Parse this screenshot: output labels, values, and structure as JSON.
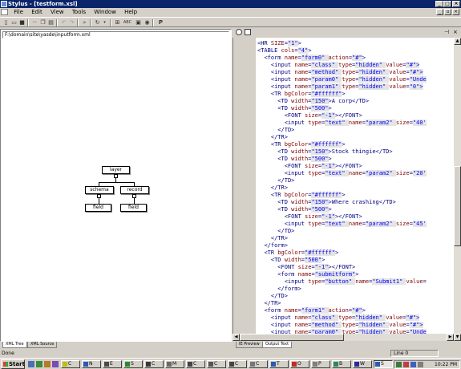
{
  "window": {
    "title": "Stylus - [testform.xsl]"
  },
  "menu": {
    "items": [
      "File",
      "Edit",
      "View",
      "Tools",
      "Window",
      "Help"
    ]
  },
  "toolbar": {
    "abc_label": "ABC",
    "p_label": "P"
  },
  "left_pane": {
    "path": "F:\\domain\\site\\yasde\\inputform.xml",
    "tree": {
      "root": "layer",
      "child1": "schema",
      "child2": "record",
      "leaf1": "field",
      "leaf2": "field"
    },
    "tabs": [
      "XML Tree",
      "XML Source"
    ]
  },
  "right_pane": {
    "code_lines": [
      [
        "",
        [
          [
            "t",
            "<HR "
          ],
          [
            "a",
            "SIZE"
          ],
          [
            "t",
            "="
          ],
          [
            "v",
            "\"1\""
          ],
          [
            "t",
            ">"
          ]
        ]
      ],
      [
        "",
        [
          [
            "t",
            "<TABLE "
          ],
          [
            "a",
            "cols"
          ],
          [
            "t",
            "="
          ],
          [
            "v",
            "\"4\""
          ],
          [
            "t",
            ">"
          ]
        ]
      ],
      [
        "  ",
        [
          [
            "t",
            "<form "
          ],
          [
            "a",
            "name"
          ],
          [
            "t",
            "="
          ],
          [
            "v",
            "\"form0\" "
          ],
          [
            "a",
            "action"
          ],
          [
            "t",
            "="
          ],
          [
            "v",
            "\"#\""
          ],
          [
            "t",
            ">"
          ]
        ]
      ],
      [
        "    ",
        [
          [
            "t",
            "<input "
          ],
          [
            "a",
            "name"
          ],
          [
            "t",
            "="
          ],
          [
            "v",
            "\"class\" "
          ],
          [
            "a",
            "type"
          ],
          [
            "t",
            "="
          ],
          [
            "v",
            "\"hidden\" "
          ],
          [
            "a",
            "value"
          ],
          [
            "t",
            "="
          ],
          [
            "v",
            "\"#\">"
          ]
        ]
      ],
      [
        "    ",
        [
          [
            "t",
            "<input "
          ],
          [
            "a",
            "name"
          ],
          [
            "t",
            "="
          ],
          [
            "v",
            "\"method\" "
          ],
          [
            "a",
            "type"
          ],
          [
            "t",
            "="
          ],
          [
            "v",
            "\"hidden\" "
          ],
          [
            "a",
            "value"
          ],
          [
            "t",
            "="
          ],
          [
            "v",
            "\"#\">"
          ]
        ]
      ],
      [
        "    ",
        [
          [
            "t",
            "<input "
          ],
          [
            "a",
            "name"
          ],
          [
            "t",
            "="
          ],
          [
            "v",
            "\"param0\" "
          ],
          [
            "a",
            "type"
          ],
          [
            "t",
            "="
          ],
          [
            "v",
            "\"hidden\" "
          ],
          [
            "a",
            "value"
          ],
          [
            "t",
            "="
          ],
          [
            "v",
            "\"Unde"
          ]
        ]
      ],
      [
        "    ",
        [
          [
            "t",
            "<input "
          ],
          [
            "a",
            "name"
          ],
          [
            "t",
            "="
          ],
          [
            "v",
            "\"param1\" "
          ],
          [
            "a",
            "type"
          ],
          [
            "t",
            "="
          ],
          [
            "v",
            "\"hidden\" "
          ],
          [
            "a",
            "value"
          ],
          [
            "t",
            "="
          ],
          [
            "v",
            "\"0\">"
          ]
        ]
      ],
      [
        "    ",
        [
          [
            "t",
            "<TR "
          ],
          [
            "a",
            "bgColor"
          ],
          [
            "t",
            "="
          ],
          [
            "v",
            "\"#ffffff\""
          ],
          [
            "t",
            ">"
          ]
        ]
      ],
      [
        "      ",
        [
          [
            "t",
            "<TD "
          ],
          [
            "a",
            "width"
          ],
          [
            "t",
            "="
          ],
          [
            "v",
            "\"150\""
          ],
          [
            "t",
            ">A corp</TD>"
          ]
        ]
      ],
      [
        "      ",
        [
          [
            "t",
            "<TD "
          ],
          [
            "a",
            "width"
          ],
          [
            "t",
            "="
          ],
          [
            "v",
            "\"500\""
          ],
          [
            "t",
            ">"
          ]
        ]
      ],
      [
        "        ",
        [
          [
            "t",
            "<FONT "
          ],
          [
            "a",
            "size"
          ],
          [
            "t",
            "="
          ],
          [
            "v",
            "\"-1\""
          ],
          [
            "t",
            "></FONT>"
          ]
        ]
      ],
      [
        "        ",
        [
          [
            "t",
            "<input "
          ],
          [
            "a",
            "type"
          ],
          [
            "t",
            "="
          ],
          [
            "v",
            "\"text\" "
          ],
          [
            "a",
            "name"
          ],
          [
            "t",
            "="
          ],
          [
            "v",
            "\"param2\" "
          ],
          [
            "a",
            "size"
          ],
          [
            "t",
            "="
          ],
          [
            "v",
            "\"40'"
          ]
        ]
      ],
      [
        "      ",
        [
          [
            "t",
            "</TD>"
          ]
        ]
      ],
      [
        "    ",
        [
          [
            "t",
            "</TR>"
          ]
        ]
      ],
      [
        "    ",
        [
          [
            "t",
            "<TR "
          ],
          [
            "a",
            "bgColor"
          ],
          [
            "t",
            "="
          ],
          [
            "v",
            "\"#ffffff\""
          ],
          [
            "t",
            ">"
          ]
        ]
      ],
      [
        "      ",
        [
          [
            "t",
            "<TD "
          ],
          [
            "a",
            "width"
          ],
          [
            "t",
            "="
          ],
          [
            "v",
            "\"150\""
          ],
          [
            "t",
            ">Stock thingie</TD>"
          ]
        ]
      ],
      [
        "      ",
        [
          [
            "t",
            "<TD "
          ],
          [
            "a",
            "width"
          ],
          [
            "t",
            "="
          ],
          [
            "v",
            "\"500\""
          ],
          [
            "t",
            ">"
          ]
        ]
      ],
      [
        "        ",
        [
          [
            "t",
            "<FONT "
          ],
          [
            "a",
            "size"
          ],
          [
            "t",
            "="
          ],
          [
            "v",
            "\"-1\""
          ],
          [
            "t",
            "></FONT>"
          ]
        ]
      ],
      [
        "        ",
        [
          [
            "t",
            "<input "
          ],
          [
            "a",
            "type"
          ],
          [
            "t",
            "="
          ],
          [
            "v",
            "\"text\" "
          ],
          [
            "a",
            "name"
          ],
          [
            "t",
            "="
          ],
          [
            "v",
            "\"param2\" "
          ],
          [
            "a",
            "size"
          ],
          [
            "t",
            "="
          ],
          [
            "v",
            "\"20'"
          ]
        ]
      ],
      [
        "      ",
        [
          [
            "t",
            "</TD>"
          ]
        ]
      ],
      [
        "    ",
        [
          [
            "t",
            "</TR>"
          ]
        ]
      ],
      [
        "    ",
        [
          [
            "t",
            "<TR "
          ],
          [
            "a",
            "bgColor"
          ],
          [
            "t",
            "="
          ],
          [
            "v",
            "\"#ffffff\""
          ],
          [
            "t",
            ">"
          ]
        ]
      ],
      [
        "      ",
        [
          [
            "t",
            "<TD "
          ],
          [
            "a",
            "width"
          ],
          [
            "t",
            "="
          ],
          [
            "v",
            "\"150\""
          ],
          [
            "t",
            ">Where crashing</TD>"
          ]
        ]
      ],
      [
        "      ",
        [
          [
            "t",
            "<TD "
          ],
          [
            "a",
            "width"
          ],
          [
            "t",
            "="
          ],
          [
            "v",
            "\"500\""
          ],
          [
            "t",
            ">"
          ]
        ]
      ],
      [
        "        ",
        [
          [
            "t",
            "<FONT "
          ],
          [
            "a",
            "size"
          ],
          [
            "t",
            "="
          ],
          [
            "v",
            "\"-1\""
          ],
          [
            "t",
            "></FONT>"
          ]
        ]
      ],
      [
        "        ",
        [
          [
            "t",
            "<input "
          ],
          [
            "a",
            "type"
          ],
          [
            "t",
            "="
          ],
          [
            "v",
            "\"text\" "
          ],
          [
            "a",
            "name"
          ],
          [
            "t",
            "="
          ],
          [
            "v",
            "\"param2\" "
          ],
          [
            "a",
            "size"
          ],
          [
            "t",
            "="
          ],
          [
            "v",
            "\"45'"
          ]
        ]
      ],
      [
        "      ",
        [
          [
            "t",
            "</TD>"
          ]
        ]
      ],
      [
        "    ",
        [
          [
            "t",
            "</TR>"
          ]
        ]
      ],
      [
        "  ",
        [
          [
            "t",
            "</form>"
          ]
        ]
      ],
      [
        "  ",
        [
          [
            "t",
            "<TR "
          ],
          [
            "a",
            "bgColor"
          ],
          [
            "t",
            "="
          ],
          [
            "v",
            "\"#ffffff\""
          ],
          [
            "t",
            ">"
          ]
        ]
      ],
      [
        "    ",
        [
          [
            "t",
            "<TD "
          ],
          [
            "a",
            "width"
          ],
          [
            "t",
            "="
          ],
          [
            "v",
            "\"500\""
          ],
          [
            "t",
            ">"
          ]
        ]
      ],
      [
        "      ",
        [
          [
            "t",
            "<FONT "
          ],
          [
            "a",
            "size"
          ],
          [
            "t",
            "="
          ],
          [
            "v",
            "\"-1\""
          ],
          [
            "t",
            "></FONT>"
          ]
        ]
      ],
      [
        "      ",
        [
          [
            "t",
            "<form "
          ],
          [
            "a",
            "name"
          ],
          [
            "t",
            "="
          ],
          [
            "v",
            "\"submitform\""
          ],
          [
            "t",
            ">"
          ]
        ]
      ],
      [
        "        ",
        [
          [
            "t",
            "<input "
          ],
          [
            "a",
            "type"
          ],
          [
            "t",
            "="
          ],
          [
            "v",
            "\"button\" "
          ],
          [
            "a",
            "name"
          ],
          [
            "t",
            "="
          ],
          [
            "v",
            "\"Submit1\" "
          ],
          [
            "a",
            "value"
          ],
          [
            "t",
            "="
          ]
        ]
      ],
      [
        "      ",
        [
          [
            "t",
            "</form>"
          ]
        ]
      ],
      [
        "    ",
        [
          [
            "t",
            "</TD>"
          ]
        ]
      ],
      [
        "  ",
        [
          [
            "t",
            "</TR>"
          ]
        ]
      ],
      [
        "  ",
        [
          [
            "t",
            "<form "
          ],
          [
            "a",
            "name"
          ],
          [
            "t",
            "="
          ],
          [
            "v",
            "\"form1\" "
          ],
          [
            "a",
            "action"
          ],
          [
            "t",
            "="
          ],
          [
            "v",
            "\"#\""
          ],
          [
            "t",
            ">"
          ]
        ]
      ],
      [
        "    ",
        [
          [
            "t",
            "<input "
          ],
          [
            "a",
            "name"
          ],
          [
            "t",
            "="
          ],
          [
            "v",
            "\"class\" "
          ],
          [
            "a",
            "type"
          ],
          [
            "t",
            "="
          ],
          [
            "v",
            "\"hidden\" "
          ],
          [
            "a",
            "value"
          ],
          [
            "t",
            "="
          ],
          [
            "v",
            "\"#\">"
          ]
        ]
      ],
      [
        "    ",
        [
          [
            "t",
            "<input "
          ],
          [
            "a",
            "name"
          ],
          [
            "t",
            "="
          ],
          [
            "v",
            "\"method\" "
          ],
          [
            "a",
            "type"
          ],
          [
            "t",
            "="
          ],
          [
            "v",
            "\"hidden\" "
          ],
          [
            "a",
            "value"
          ],
          [
            "t",
            "="
          ],
          [
            "v",
            "\"#\">"
          ]
        ]
      ],
      [
        "    ",
        [
          [
            "t",
            "<input "
          ],
          [
            "a",
            "name"
          ],
          [
            "t",
            "="
          ],
          [
            "v",
            "\"param0\" "
          ],
          [
            "a",
            "type"
          ],
          [
            "t",
            "="
          ],
          [
            "v",
            "\"hidden\" "
          ],
          [
            "a",
            "value"
          ],
          [
            "t",
            "="
          ],
          [
            "v",
            "\"Unde"
          ]
        ]
      ]
    ],
    "tabs": [
      "IE Preview",
      "Output Text"
    ]
  },
  "status": {
    "left": "Done",
    "line": "Line 0"
  },
  "taskbar": {
    "start_label": "Start",
    "buttons": [
      "C",
      "N",
      "E",
      "S",
      "C",
      "M",
      "C",
      "C",
      "C",
      "C",
      "T",
      "O",
      "P",
      "B",
      "W",
      "S"
    ],
    "clock": "10:22 PM"
  }
}
